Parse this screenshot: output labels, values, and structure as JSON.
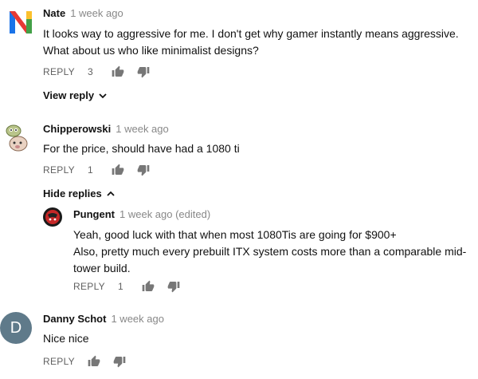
{
  "comments": [
    {
      "author": "Nate",
      "time": "1 week ago",
      "line1": "It looks way to aggressive for me. I don't get why gamer instantly means aggressive.",
      "line2": "What about us who like minimalist designs?",
      "reply_label": "REPLY",
      "likes": "3",
      "toggle_label": "View reply"
    },
    {
      "author": "Chipperowski",
      "time": "1 week ago",
      "line1": "For the price, should have had a 1080 ti",
      "reply_label": "REPLY",
      "likes": "1",
      "toggle_label": "Hide replies",
      "replies": [
        {
          "author": "Pungent",
          "time": "1 week ago (edited)",
          "line1": "Yeah, good luck with that when most 1080Tis are going for $900+",
          "line2": "Also, pretty much every prebuilt ITX system costs more than a comparable mid-",
          "line3": "tower build.",
          "reply_label": "REPLY",
          "likes": "1"
        }
      ]
    },
    {
      "author": "Danny Schot",
      "time": "1 week ago",
      "avatar_letter": "D",
      "avatar_color": "#5f7a8a",
      "line1": "Nice nice",
      "reply_label": "REPLY"
    }
  ],
  "icons": {
    "like": "thumbs-up-icon",
    "dislike": "thumbs-down-icon",
    "expand": "chevron-down-icon",
    "collapse": "chevron-up-icon"
  },
  "colors": {
    "action_gray": "#606060",
    "time_gray": "#888888"
  }
}
